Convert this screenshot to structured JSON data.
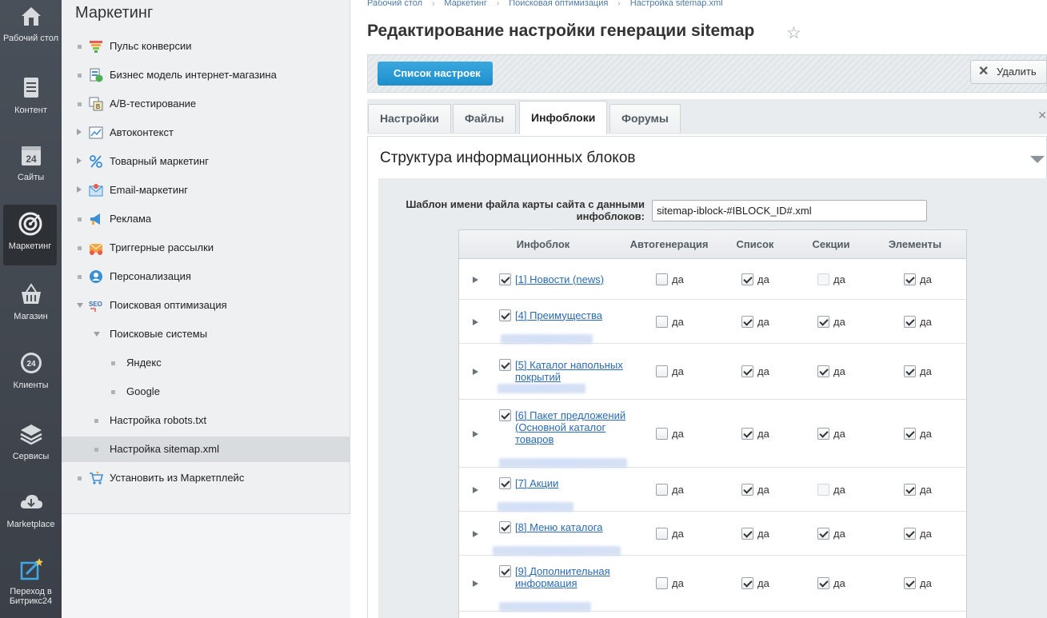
{
  "iconbar": [
    {
      "label": "Рабочий стол",
      "icon": "house-icon"
    },
    {
      "label": "Контент",
      "icon": "document-icon"
    },
    {
      "label": "Сайты",
      "icon": "calendar-24-icon"
    },
    {
      "label": "Маркетинг",
      "icon": "target-icon",
      "active": true
    },
    {
      "label": "Магазин",
      "icon": "basket-icon"
    },
    {
      "label": "Клиенты",
      "icon": "clients-24-icon"
    },
    {
      "label": "Сервисы",
      "icon": "layers-icon"
    },
    {
      "label": "Marketplace",
      "icon": "cloud-download-icon"
    },
    {
      "label": "Переход в Битрикс24",
      "icon": "edit-star-icon"
    }
  ],
  "menu": {
    "title": "Маркетинг",
    "items": [
      {
        "label": "Пульс конверсии",
        "icon": "funnel-icon",
        "marker": "bullet"
      },
      {
        "label": "Бизнес модель интернет-магазина",
        "icon": "business-model-icon",
        "marker": "bullet"
      },
      {
        "label": "А/В-тестирование",
        "icon": "ab-test-icon",
        "marker": "bullet"
      },
      {
        "label": "Автоконтекст",
        "icon": "chart-icon",
        "marker": "arrow"
      },
      {
        "label": "Товарный маркетинг",
        "icon": "percent-icon",
        "marker": "arrow"
      },
      {
        "label": "Email-маркетинг",
        "icon": "email-icon",
        "marker": "arrow"
      },
      {
        "label": "Реклама",
        "icon": "megaphone-icon",
        "marker": "bullet"
      },
      {
        "label": "Триггерные рассылки",
        "icon": "trigger-mail-icon",
        "marker": "bullet"
      },
      {
        "label": "Персонализация",
        "icon": "person-icon",
        "marker": "bullet"
      },
      {
        "label": "Поисковая оптимизация",
        "icon": "seo-icon",
        "marker": "open"
      },
      {
        "label": "Поисковые системы",
        "marker": "open-sub"
      },
      {
        "label": "Яндекс",
        "marker": "bullet-sub2"
      },
      {
        "label": "Google",
        "marker": "bullet-sub2"
      },
      {
        "label": "Настройка robots.txt",
        "marker": "bullet-sub"
      },
      {
        "label": "Настройка sitemap.xml",
        "marker": "bullet-sub",
        "selected": true
      },
      {
        "label": "Установить из Маркетплейс",
        "icon": "cart-icon",
        "marker": "bullet"
      }
    ]
  },
  "breadcrumbs": [
    "Рабочий стол",
    "Маркетинг",
    "Поисковая оптимизация",
    "Настройка sitemap.xml"
  ],
  "page_title": "Редактирование настройки генерации sitemap",
  "toolbar": {
    "list_button": "Список настроек",
    "delete_button": "Удалить"
  },
  "tabs": [
    {
      "label": "Настройки"
    },
    {
      "label": "Файлы"
    },
    {
      "label": "Инфоблоки",
      "active": true
    },
    {
      "label": "Форумы"
    }
  ],
  "section": {
    "title": "Структура информационных блоков",
    "template_label": "Шаблон имени файла карты сайта с данными инфоблоков:",
    "template_value": "sitemap-iblock-#IBLOCK_ID#.xml"
  },
  "grid": {
    "headers": [
      "Инфоблок",
      "Автогенерация",
      "Список",
      "Секции",
      "Элементы"
    ],
    "checkbox_label": "да",
    "rows": [
      {
        "id": "[1]",
        "name": "Новости (news)",
        "auto": false,
        "list": true,
        "sections": null,
        "elements": true
      },
      {
        "id": "[4]",
        "name": "Преимущества",
        "auto": false,
        "list": true,
        "sections": true,
        "elements": true
      },
      {
        "id": "[5]",
        "name": "Каталог напольных покрытий",
        "auto": false,
        "list": true,
        "sections": true,
        "elements": true
      },
      {
        "id": "[6]",
        "name": "Пакет предложений (Основной каталог товаров",
        "auto": false,
        "list": true,
        "sections": true,
        "elements": true
      },
      {
        "id": "[7]",
        "name": "Акции",
        "auto": false,
        "list": true,
        "sections": null,
        "elements": true
      },
      {
        "id": "[8]",
        "name": "Меню каталога",
        "auto": false,
        "list": true,
        "sections": true,
        "elements": true
      },
      {
        "id": "[9]",
        "name": "Дополнительная информация",
        "auto": false,
        "list": true,
        "sections": true,
        "elements": true
      }
    ]
  },
  "colors": {
    "accent": "#2a9bd5",
    "sidebar": "#444a52",
    "link": "#2a6ab3"
  }
}
